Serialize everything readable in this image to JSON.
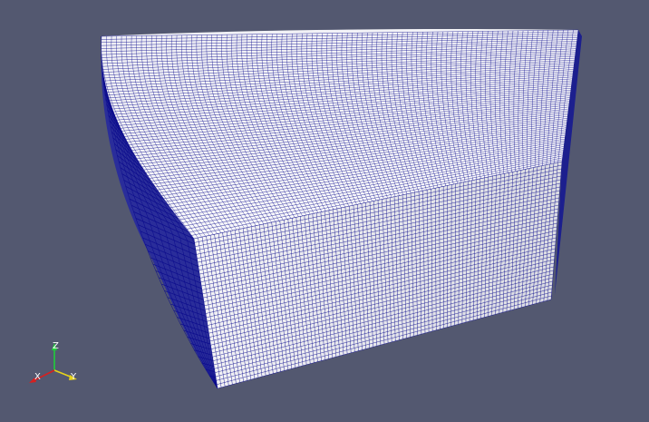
{
  "viewport": {
    "background": "#535870",
    "mesh": {
      "surface_color": "#ffffff",
      "edge_color": "#0a0a8c"
    }
  },
  "orientation_axes": {
    "x": {
      "label": "X",
      "color": "#d62020"
    },
    "y": {
      "label": "Y",
      "color": "#e6d21a"
    },
    "z": {
      "label": "Z",
      "color": "#1fcf3a"
    }
  }
}
